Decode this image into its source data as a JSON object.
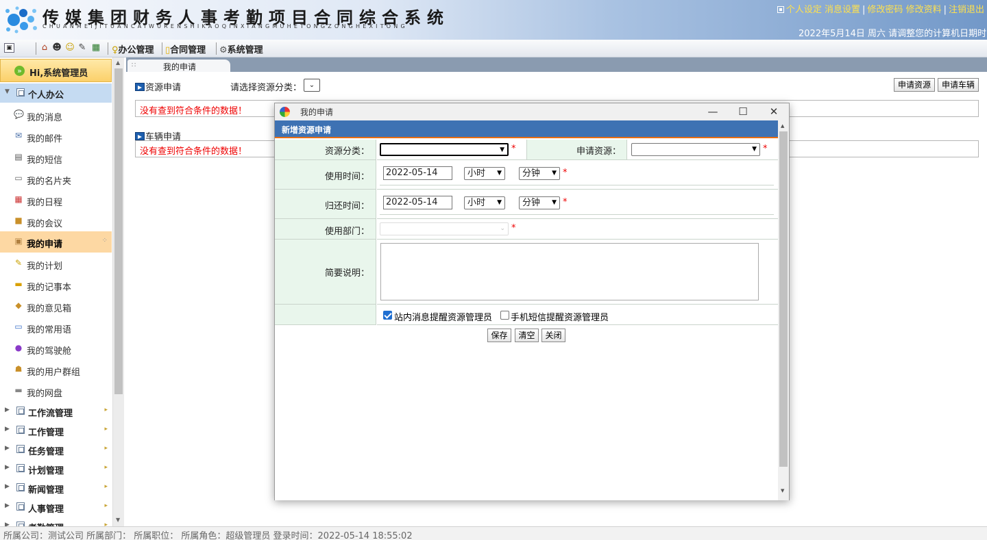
{
  "header": {
    "title": "传媒集团财务人事考勤项目合同综合系统",
    "pinyin": "CHUANMEIJITUANCAIWURENSHIKAOQINXIANGMUHETONGZONGHEXITONG",
    "links": [
      "个人设定",
      "消息设置",
      "修改密码",
      "修改资料",
      "注销退出"
    ],
    "date_line": "2022年5月14日 周六   请调整您的计算机日期时"
  },
  "toolbar": {
    "menus": [
      "办公管理",
      "合同管理",
      "系统管理"
    ]
  },
  "sidebar": {
    "greeting": "Hi,系统管理员",
    "open_section": "个人办公",
    "items": [
      "我的消息",
      "我的邮件",
      "我的短信",
      "我的名片夹",
      "我的日程",
      "我的会议",
      "我的申请",
      "我的计划",
      "我的记事本",
      "我的意见箱",
      "我的常用语",
      "我的驾驶舱",
      "我的用户群组",
      "我的网盘"
    ],
    "active_item": "我的申请",
    "collapsed_sections": [
      "工作流管理",
      "工作管理",
      "任务管理",
      "计划管理",
      "新闻管理",
      "人事管理",
      "考勤管理"
    ]
  },
  "main": {
    "tab_title": "我的申请",
    "resource_section_title": "资源申请",
    "filter_label": "请选择资源分类：",
    "buttons": [
      "申请资源",
      "申请车辆"
    ],
    "vehicle_section_title": "车辆申请",
    "no_data_msg": "没有查到符合条件的数据！"
  },
  "dialog": {
    "window_title": "我的申请",
    "form_title": "新增资源申请",
    "labels": {
      "category": "资源分类：",
      "resource": "申请资源：",
      "use_time": "使用时间：",
      "return_time": "归还时间：",
      "department": "使用部门：",
      "description": "简要说明："
    },
    "use_date": "2022-05-14",
    "return_date": "2022-05-14",
    "hour_option": "小时",
    "minute_option": "分钟",
    "required_mark": "*",
    "checkbox_internal": "站内消息提醒资源管理员",
    "checkbox_internal_checked": true,
    "checkbox_sms": "手机短信提醒资源管理员",
    "checkbox_sms_checked": false,
    "buttons": [
      "保存",
      "清空",
      "关闭"
    ]
  },
  "status": {
    "text": "所属公司：测试公司  所属部门：  所属职位：  所属角色：超级管理员  登录时间：2022-05-14 18:55:02"
  },
  "colors": {
    "form_header": "#3e72b3",
    "form_header_border": "#e96e12",
    "label_cell_bg": "#e9f6ec",
    "active_item_bg": "#fdd8a3",
    "error_text": "#e00000",
    "header_link": "#ffe14d"
  },
  "icons": {
    "logo": "dots-logo-icon",
    "toolbar": [
      "home-icon",
      "user-icon",
      "smiley-icon",
      "edit-icon",
      "calendar-icon"
    ],
    "side_items": [
      "message-icon",
      "mail-icon",
      "sms-icon",
      "cardcase-icon",
      "calendar-icon",
      "meeting-icon",
      "apply-icon",
      "plan-icon",
      "notebook-icon",
      "suggestion-icon",
      "phrase-icon",
      "cockpit-icon",
      "group-icon",
      "disk-icon"
    ]
  }
}
